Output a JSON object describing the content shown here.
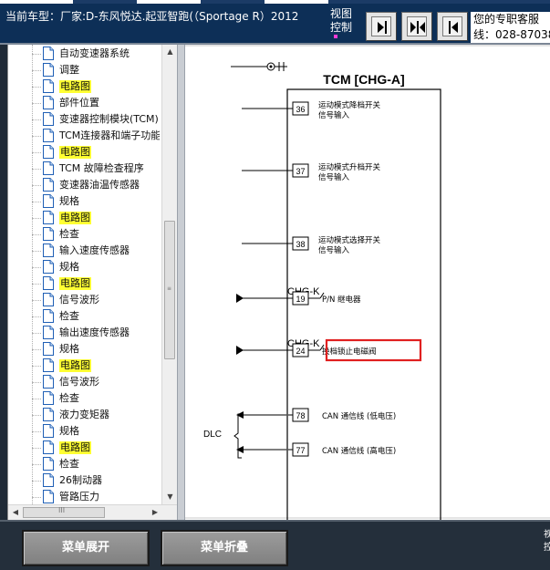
{
  "header": {
    "vehicle_label": "当前车型：厂家:D-东风悦达.起亚智跑(（Sportage R）2012",
    "view_control_label": "视图控制",
    "info_box_line1": "您的专职客服",
    "info_box_line2": "线：028-87038"
  },
  "toolbar": {
    "buttons": [
      {
        "name": "expand-right-button",
        "icon": "arrow-right-bar-icon"
      },
      {
        "name": "split-view-button",
        "icon": "arrows-split-icon"
      },
      {
        "name": "expand-left-button",
        "icon": "arrow-left-bar-icon"
      }
    ]
  },
  "tree": {
    "items": [
      {
        "label": "自动变速器系统",
        "highlight": false
      },
      {
        "label": "调整",
        "highlight": false
      },
      {
        "label": "电路图",
        "highlight": true
      },
      {
        "label": "部件位置",
        "highlight": false
      },
      {
        "label": "变速器控制模块(TCM)",
        "highlight": false
      },
      {
        "label": "TCM连接器和端子功能",
        "highlight": false
      },
      {
        "label": "电路图",
        "highlight": true
      },
      {
        "label": "TCM 故障检查程序",
        "highlight": false
      },
      {
        "label": "变速器油温传感器",
        "highlight": false
      },
      {
        "label": "规格",
        "highlight": false
      },
      {
        "label": "电路图",
        "highlight": true
      },
      {
        "label": "检查",
        "highlight": false
      },
      {
        "label": "输入速度传感器",
        "highlight": false
      },
      {
        "label": "规格",
        "highlight": false
      },
      {
        "label": "电路图",
        "highlight": true
      },
      {
        "label": "信号波形",
        "highlight": false
      },
      {
        "label": "检查",
        "highlight": false
      },
      {
        "label": "输出速度传感器",
        "highlight": false
      },
      {
        "label": "规格",
        "highlight": false
      },
      {
        "label": "电路图",
        "highlight": true
      },
      {
        "label": "信号波形",
        "highlight": false
      },
      {
        "label": "检查",
        "highlight": false
      },
      {
        "label": "液力变矩器",
        "highlight": false
      },
      {
        "label": "规格",
        "highlight": false
      },
      {
        "label": "电路图",
        "highlight": true
      },
      {
        "label": "检查",
        "highlight": false
      },
      {
        "label": "26制动器",
        "highlight": false
      },
      {
        "label": "管路压力",
        "highlight": false
      }
    ],
    "hscroll_grip": "III",
    "vscroll_grip": "≡"
  },
  "diagram": {
    "title": "TCM [CHG-A]",
    "pins": [
      {
        "num": "36",
        "line1": "运动模式降档开关",
        "line2": "信号输入"
      },
      {
        "num": "37",
        "line1": "运动模式升档开关",
        "line2": "信号输入"
      },
      {
        "num": "38",
        "line1": "运动模式选择开关",
        "line2": "信号输入"
      },
      {
        "num": "19",
        "connector": "CHG-K",
        "line1": "P/N 继电器"
      },
      {
        "num": "24",
        "connector": "CHG-K",
        "line1": "换档锁止电磁阀"
      },
      {
        "num": "78",
        "line1": "CAN 通信线 (低电压)"
      },
      {
        "num": "77",
        "line1": "CAN 通信线 (高电压)"
      }
    ],
    "dlc_label": "DLC",
    "highlight_color": "#e02020"
  },
  "bottom": {
    "expand_label": "菜单展开",
    "collapse_label": "菜单折叠",
    "side_text": "视控"
  }
}
